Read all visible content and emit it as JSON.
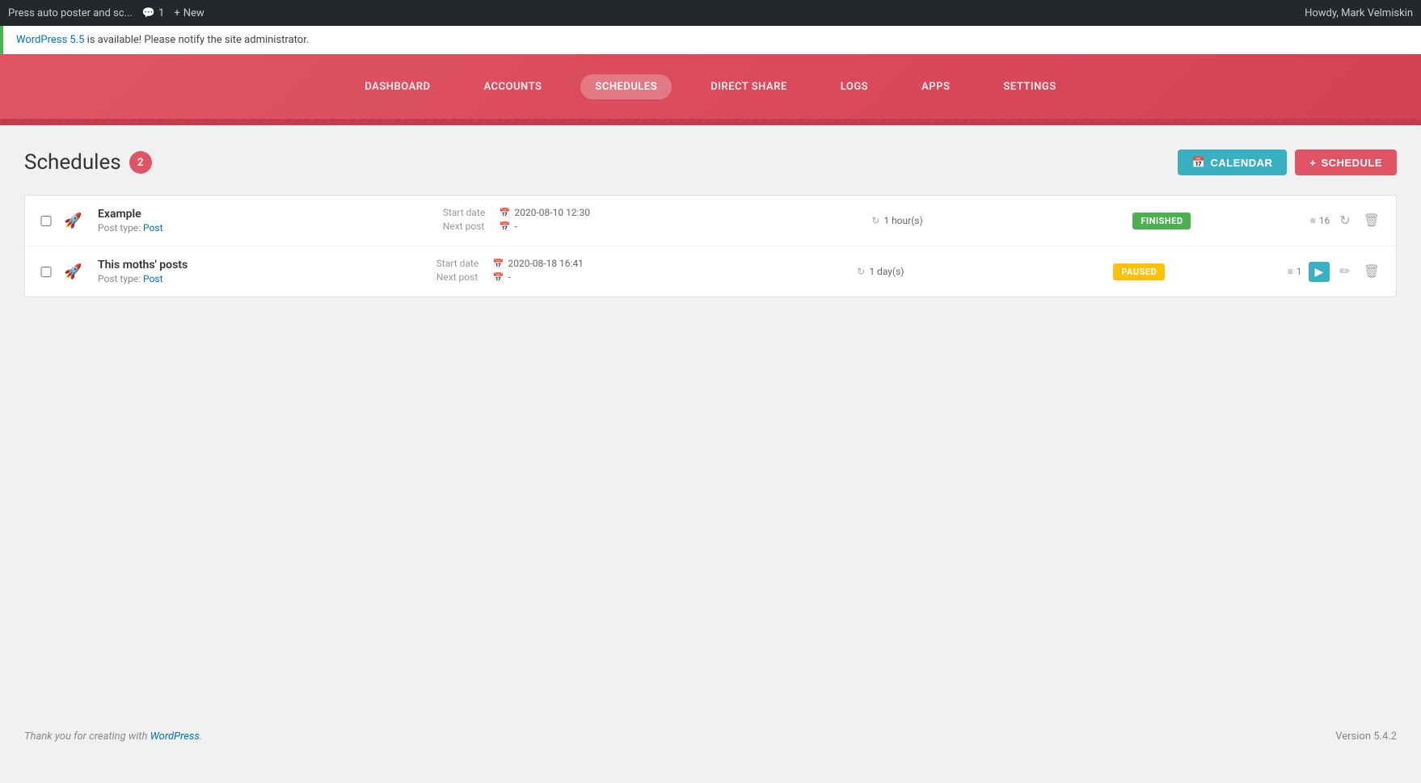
{
  "adminBar": {
    "title": "Press auto poster and sc...",
    "comments_label": "1",
    "new_label": "New",
    "user_greeting": "Howdy, Mark Velmiskin"
  },
  "notice": {
    "link_text": "WordPress 5.5",
    "message": " is available! Please notify the site administrator."
  },
  "nav": {
    "items": [
      {
        "id": "dashboard",
        "label": "DASHBOARD",
        "active": false
      },
      {
        "id": "accounts",
        "label": "ACCOUNTS",
        "active": false
      },
      {
        "id": "schedules",
        "label": "SCHEDULES",
        "active": true
      },
      {
        "id": "direct-share",
        "label": "DIRECT SHARE",
        "active": false
      },
      {
        "id": "logs",
        "label": "LOGS",
        "active": false
      },
      {
        "id": "apps",
        "label": "APPS",
        "active": false
      },
      {
        "id": "settings",
        "label": "SETTINGS",
        "active": false
      }
    ]
  },
  "page": {
    "title": "Schedules",
    "count": "2",
    "btn_calendar": "CALENDAR",
    "btn_schedule": "SCHEDULE"
  },
  "schedules": [
    {
      "id": "schedule-1",
      "name": "Example",
      "post_type_label": "Post type:",
      "post_type_link": "Post",
      "start_date_label": "Start date",
      "start_date": "2020-08-10 12:30",
      "next_post_label": "Next post",
      "next_post_value": "-",
      "interval": "1 hour(s)",
      "status": "FINISHED",
      "status_type": "finished",
      "item_count": "16",
      "show_play": false
    },
    {
      "id": "schedule-2",
      "name": "This moths' posts",
      "post_type_label": "Post type:",
      "post_type_link": "Post",
      "start_date_label": "Start date",
      "start_date": "2020-08-18 16:41",
      "next_post_label": "Next post",
      "next_post_value": "-",
      "interval": "1 day(s)",
      "status": "PAUSED",
      "status_type": "paused",
      "item_count": "1",
      "show_play": true
    }
  ],
  "footer": {
    "thank_you_text": "Thank you for creating with ",
    "wp_link_text": "WordPress",
    "period": ".",
    "version": "Version 5.4.2"
  },
  "icons": {
    "calendar": "📅",
    "plus": "+",
    "comments": "💬",
    "rocket": "🚀",
    "refresh": "↻",
    "date_cal": "📅",
    "list": "≡",
    "edit": "✏",
    "trash": "🗑",
    "play": "▶"
  }
}
